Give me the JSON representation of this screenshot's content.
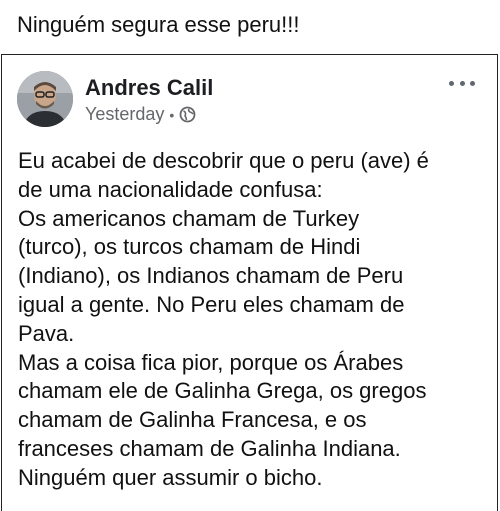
{
  "caption": "Ninguém segura esse peru!!!",
  "post": {
    "author": "Andres Calil",
    "timestamp": "Yesterday",
    "separator": "•",
    "privacy_icon": "globe-icon",
    "menu_icon": "more-options-icon",
    "body_lines": [
      "Eu acabei de descobrir que o peru (ave) é",
      "de uma nacionalidade confusa:",
      "Os americanos chamam de Turkey",
      "(turco), os turcos chamam de Hindi",
      "(Indiano), os Indianos chamam de Peru",
      "igual a gente. No Peru eles chamam de",
      "Pava.",
      "Mas a coisa fica pior, porque os Árabes",
      "chamam ele de Galinha Grega, os gregos",
      "chamam de Galinha Francesa, e os",
      "franceses chamam de Galinha Indiana.",
      "Ninguém quer assumir o bicho."
    ]
  },
  "colors": {
    "author_text": "#1c1e21",
    "meta_text": "#65676b",
    "border": "#222222"
  }
}
